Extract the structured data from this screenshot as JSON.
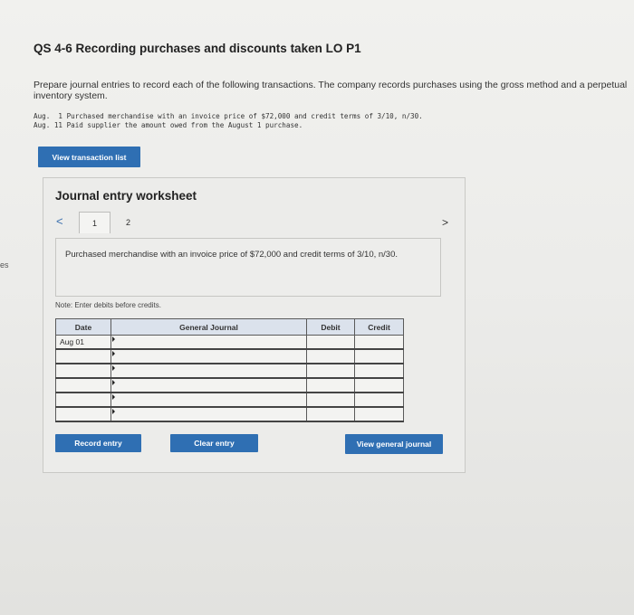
{
  "side_fragment": "es",
  "title": "QS 4-6 Recording purchases and discounts taken LO P1",
  "instructions": "Prepare journal entries to record each of the following transactions. The company records purchases using the gross method and a perpetual inventory system.",
  "transactions": [
    "Aug.  1 Purchased merchandise with an invoice price of $72,000 and credit terms of 3/10, n/30.",
    "Aug. 11 Paid supplier the amount owed from the August 1 purchase."
  ],
  "view_transaction_list_label": "View transaction list",
  "worksheet": {
    "title": "Journal entry worksheet",
    "prev_symbol": "<",
    "next_symbol": ">",
    "pages": [
      "1",
      "2"
    ],
    "active_page": "1",
    "description": "Purchased merchandise with an invoice price of $72,000 and credit terms of 3/10, n/30.",
    "note": "Note: Enter debits before credits.",
    "table": {
      "headers": {
        "date": "Date",
        "journal": "General Journal",
        "debit": "Debit",
        "credit": "Credit"
      },
      "rows": [
        {
          "date": "Aug 01",
          "journal": "",
          "debit": "",
          "credit": ""
        },
        {
          "date": "",
          "journal": "",
          "debit": "",
          "credit": ""
        },
        {
          "date": "",
          "journal": "",
          "debit": "",
          "credit": ""
        },
        {
          "date": "",
          "journal": "",
          "debit": "",
          "credit": ""
        },
        {
          "date": "",
          "journal": "",
          "debit": "",
          "credit": ""
        },
        {
          "date": "",
          "journal": "",
          "debit": "",
          "credit": ""
        }
      ]
    },
    "buttons": {
      "record": "Record entry",
      "clear": "Clear entry",
      "view_general": "View general journal"
    }
  },
  "colors": {
    "accent": "#2f6fb3",
    "header_fill": "#dbe2ec"
  }
}
